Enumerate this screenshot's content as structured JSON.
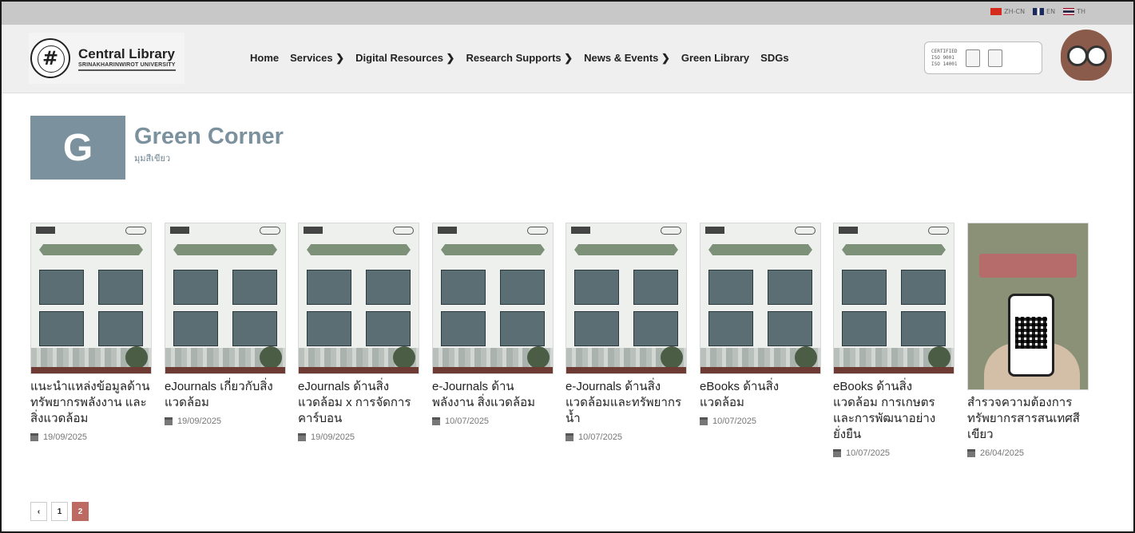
{
  "languages": [
    {
      "code": "ZH-CN"
    },
    {
      "code": "EN"
    },
    {
      "code": "TH"
    }
  ],
  "logo": {
    "title": "Central Library",
    "subtitle": "SRINAKHARINWIROT UNIVERSITY"
  },
  "nav": [
    {
      "label": "Home"
    },
    {
      "label": "Services ❯"
    },
    {
      "label": "Digital Resources ❯"
    },
    {
      "label": "Research Supports ❯"
    },
    {
      "label": "News & Events ❯"
    },
    {
      "label": "Green Library"
    },
    {
      "label": "SDGs"
    }
  ],
  "certified": {
    "line1": "CERTIFIED",
    "line2": "ISO 9001",
    "line3": "ISO 14001"
  },
  "page": {
    "letter": "G",
    "title": "Green Corner",
    "subtitle": "มุมสีเขียว"
  },
  "posts": [
    {
      "title": "แนะนำแหล่งข้อมูลด้านทรัพยากรพลังงาน และสิ่งแวดล้อม",
      "date": "19/09/2025"
    },
    {
      "title": "eJournals เกี่ยวกับสิ่งแวดล้อม",
      "date": "19/09/2025"
    },
    {
      "title": "eJournals ด้านสิ่งแวดล้อม x การจัดการคาร์บอน",
      "date": "19/09/2025"
    },
    {
      "title": "e-Journals ด้านพลังงาน สิ่งแวดล้อม",
      "date": "10/07/2025"
    },
    {
      "title": "e-Journals ด้านสิ่งแวดล้อมและทรัพยากรน้ำ",
      "date": "10/07/2025"
    },
    {
      "title": "eBooks ด้านสิ่งแวดล้อม",
      "date": "10/07/2025"
    },
    {
      "title": "eBooks ด้านสิ่งแวดล้อม การเกษตรและการพัฒนาอย่างยั่งยืน",
      "date": "10/07/2025"
    },
    {
      "title": "สำรวจความต้องการทรัพยากรสารสนเทศสีเขียว",
      "date": "26/04/2025"
    }
  ],
  "pagination": {
    "prev": "‹",
    "pages": [
      "1",
      "2"
    ],
    "current": "2"
  }
}
